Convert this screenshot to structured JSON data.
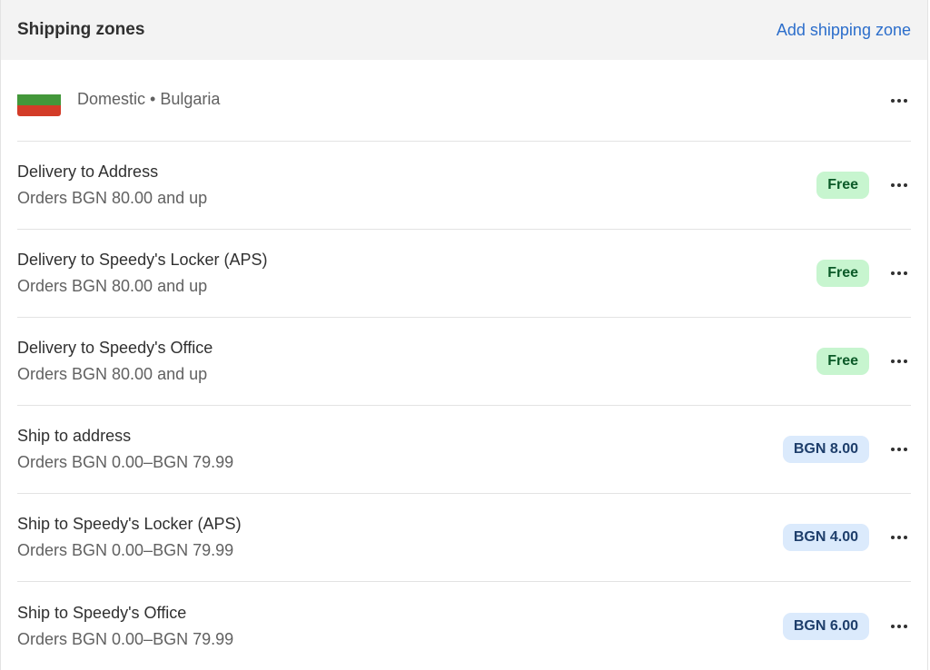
{
  "header": {
    "title": "Shipping zones",
    "add_label": "Add shipping zone"
  },
  "zone": {
    "label": "Domestic • Bulgaria",
    "flag": "bulgaria-flag",
    "flag_colors": [
      "#ffffff",
      "#43973a",
      "#d33c28"
    ]
  },
  "rates": [
    {
      "name": "Delivery to Address",
      "condition": "Orders BGN 80.00 and up",
      "price": "Free",
      "kind": "free"
    },
    {
      "name": "Delivery to Speedy's Locker (APS)",
      "condition": "Orders BGN 80.00 and up",
      "price": "Free",
      "kind": "free"
    },
    {
      "name": "Delivery to Speedy's Office",
      "condition": "Orders BGN 80.00 and up",
      "price": "Free",
      "kind": "free"
    },
    {
      "name": "Ship to address",
      "condition": "Orders BGN 0.00–BGN 79.99",
      "price": "BGN 8.00",
      "kind": "price"
    },
    {
      "name": "Ship to Speedy's Locker (APS)",
      "condition": "Orders BGN 0.00–BGN 79.99",
      "price": "BGN 4.00",
      "kind": "price"
    },
    {
      "name": "Ship to Speedy's Office",
      "condition": "Orders BGN 0.00–BGN 79.99",
      "price": "BGN 6.00",
      "kind": "price"
    }
  ],
  "colors": {
    "accent_link": "#2c6ecb",
    "free_badge_bg": "#c7f5cf",
    "price_badge_bg": "#dbeafc"
  }
}
